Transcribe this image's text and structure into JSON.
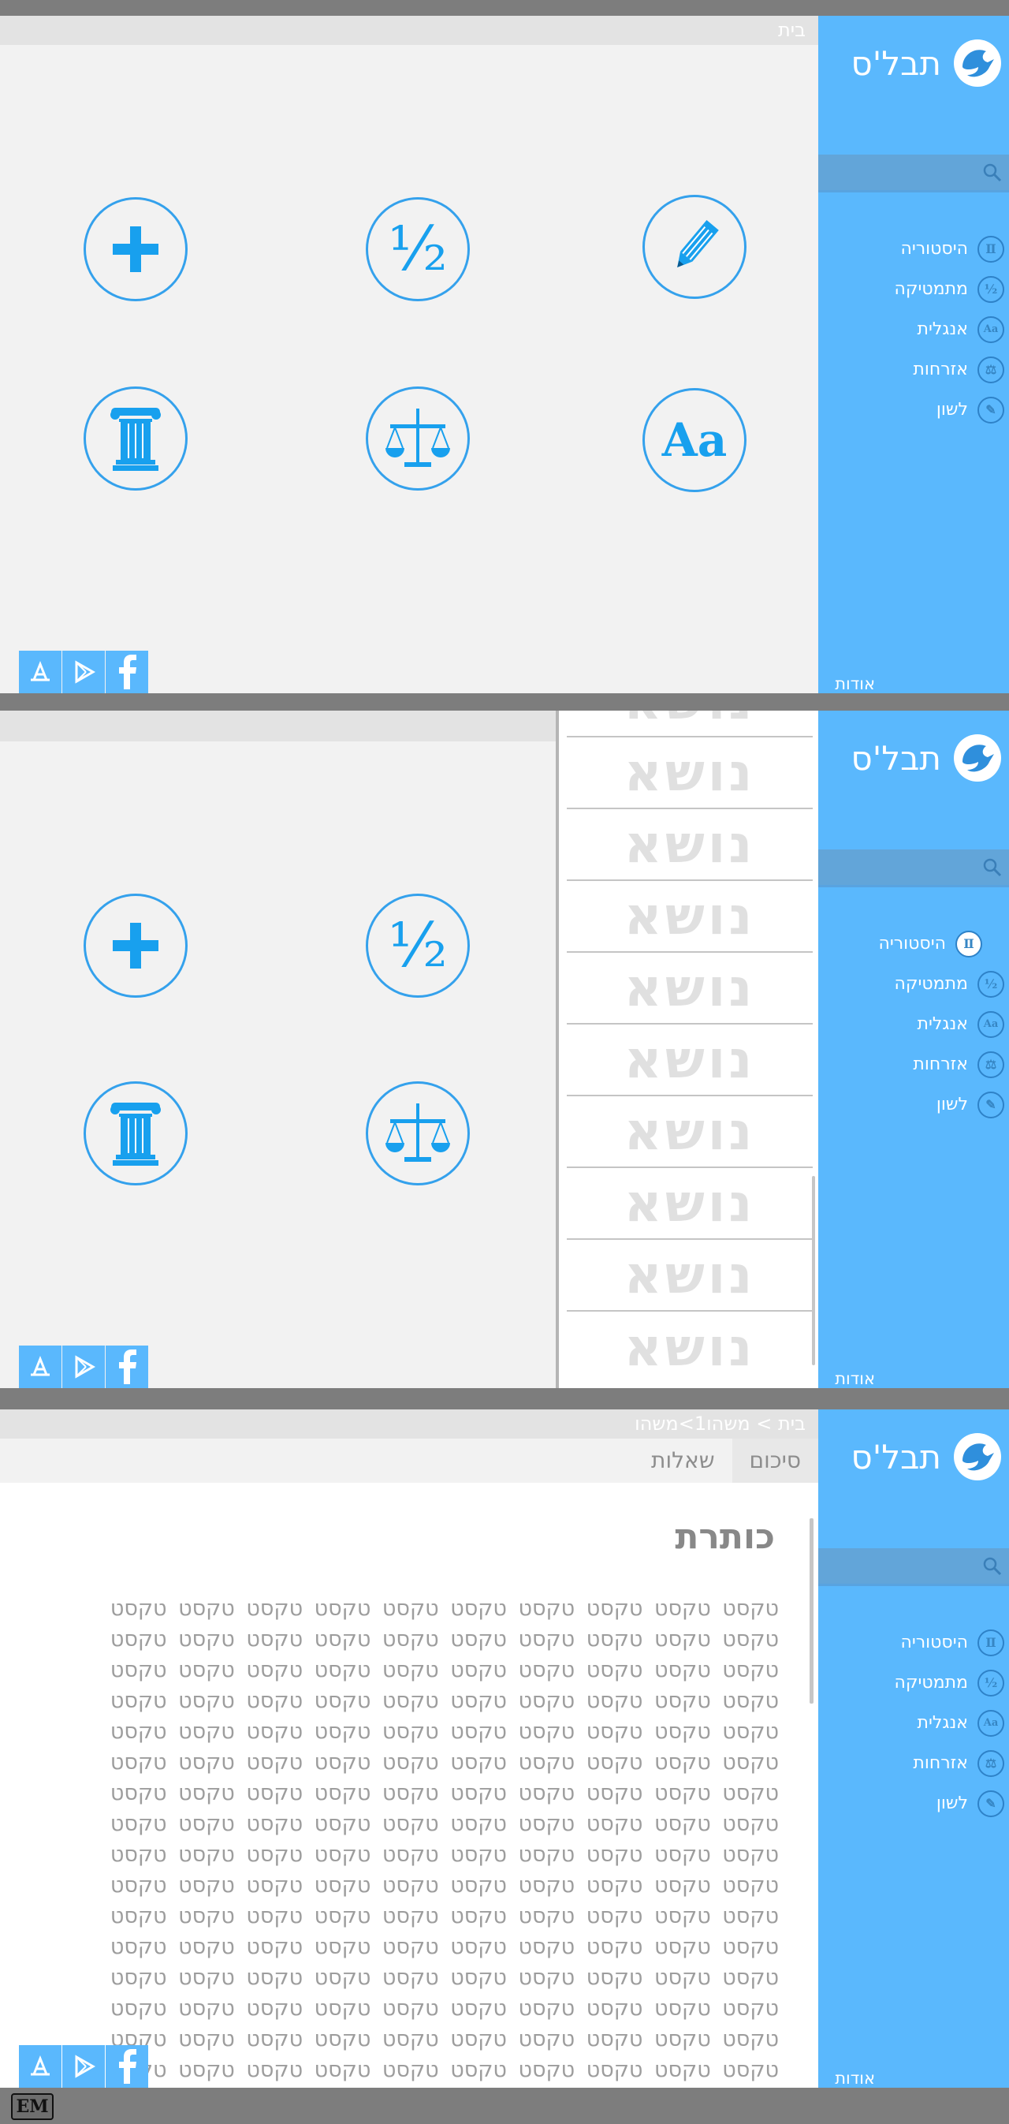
{
  "app": {
    "logo_text": "תבל'ס",
    "about_label": "אודות"
  },
  "nav": {
    "items": [
      {
        "label": "היסטוריה",
        "icon": "column-icon"
      },
      {
        "label": "מתמטיקה",
        "icon": "half-icon"
      },
      {
        "label": "אנגלית",
        "icon": "aa-icon"
      },
      {
        "label": "אזרחות",
        "icon": "scale-icon"
      },
      {
        "label": "לשון",
        "icon": "pencil-icon"
      }
    ]
  },
  "screen1": {
    "breadcrumb": "בית",
    "tiles": [
      "pencil-icon",
      "half-icon",
      "plus-icon",
      "aa-icon",
      "scale-icon",
      "column-icon"
    ],
    "half_glyph": "½",
    "aa_glyph": "Aa"
  },
  "screen2": {
    "topic_label": "נושא",
    "topic_count": 10
  },
  "screen3": {
    "breadcrumb": "בית > משהו1>משהו",
    "tabs": [
      "סיכום",
      "שאלות"
    ],
    "heading": "כותרת",
    "body_word": "טקסט",
    "body_lines": 16
  },
  "store_buttons": [
    "app-store-icon",
    "google-play-icon",
    "facebook-icon"
  ],
  "colors": {
    "sidebar": "#5ab8fd",
    "accent": "#18a0ee",
    "background": "#f2f2f2"
  },
  "watermark": "EM"
}
